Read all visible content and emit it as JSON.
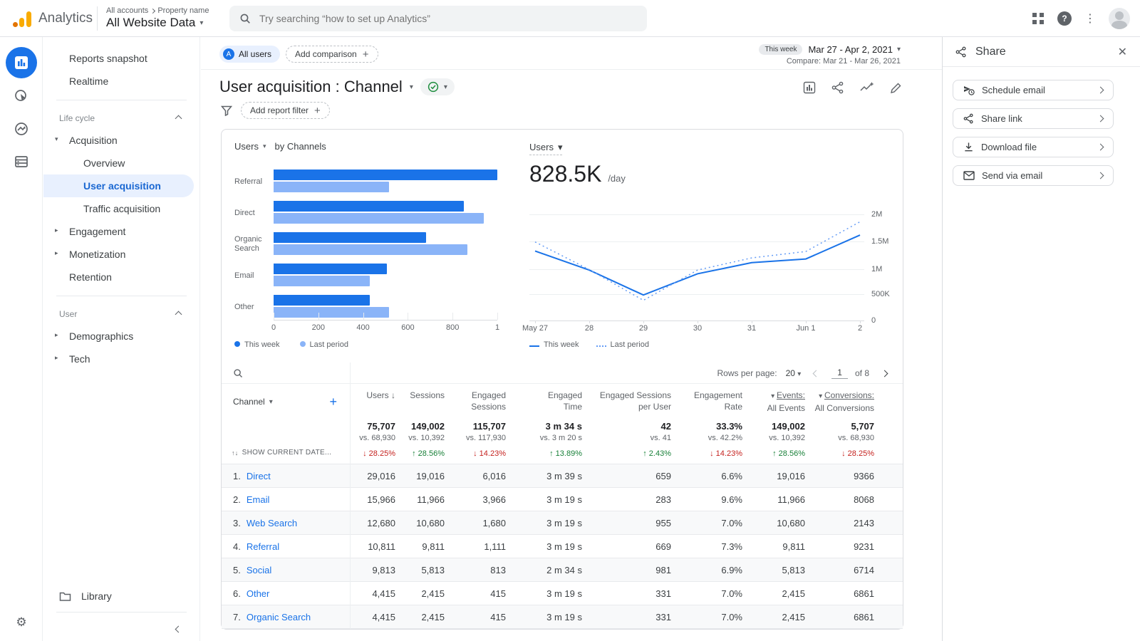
{
  "header": {
    "product": "Analytics",
    "breadcrumb": {
      "level1": "All accounts",
      "level2": "Property name"
    },
    "property_name": "All Website Data",
    "search_placeholder": "Try searching “how to set up Analytics”"
  },
  "sidebar": {
    "top_items": [
      {
        "label": "Reports snapshot"
      },
      {
        "label": "Realtime"
      }
    ],
    "sections": [
      {
        "title": "Life cycle",
        "items": [
          {
            "label": "Acquisition",
            "expand": "down",
            "children": [
              {
                "label": "Overview"
              },
              {
                "label": "User acquisition",
                "selected": true
              },
              {
                "label": "Traffic acquisition"
              }
            ]
          },
          {
            "label": "Engagement",
            "expand": "right"
          },
          {
            "label": "Monetization",
            "expand": "right"
          },
          {
            "label": "Retention"
          }
        ]
      },
      {
        "title": "User",
        "items": [
          {
            "label": "Demographics",
            "expand": "right"
          },
          {
            "label": "Tech",
            "expand": "right"
          }
        ]
      }
    ],
    "library_label": "Library"
  },
  "toolbar": {
    "all_users_icon": "A",
    "all_users_chip": "All users",
    "add_comparison": "Add comparison",
    "this_week_badge": "This week",
    "date_range": "Mar 27 - Apr 2, 2021",
    "compare_label": "Compare: Mar 21 - Mar 26, 2021"
  },
  "report": {
    "title": "User acquisition : Channel",
    "add_filter": "Add report filter"
  },
  "chart_data": [
    {
      "type": "bar",
      "orientation": "horizontal",
      "metric_label": "Users",
      "title_suffix": "by Channels",
      "categories": [
        "Referral",
        "Direct",
        "Organic Search",
        "Email",
        "Other"
      ],
      "series": [
        {
          "name": "This week",
          "color": "#1a73e8",
          "values": [
            1000,
            850,
            680,
            505,
            430
          ]
        },
        {
          "name": "Last period",
          "color": "#8ab4f8",
          "values": [
            515,
            940,
            865,
            430,
            515
          ]
        }
      ],
      "xlim": [
        0,
        1000
      ],
      "xticks": [
        "0",
        "200",
        "400",
        "600",
        "800",
        "1"
      ]
    },
    {
      "type": "line",
      "metric_label": "Users",
      "big_number": "828.5K",
      "big_number_suffix": "/day",
      "x": [
        "May 27",
        "28",
        "29",
        "30",
        "31",
        "Jun 1",
        "2"
      ],
      "series": [
        {
          "name": "This week",
          "style": "solid",
          "color": "#1a73e8",
          "values": [
            1310000,
            950000,
            480000,
            880000,
            1090000,
            1160000,
            1610000
          ]
        },
        {
          "name": "Last period",
          "style": "dotted",
          "color": "#669df6",
          "values": [
            1480000,
            960000,
            380000,
            950000,
            1180000,
            1300000,
            1860000
          ]
        }
      ],
      "ylim": [
        0,
        2000000
      ],
      "yticks": [
        "0",
        "500K",
        "1M",
        "1.5M",
        "2M"
      ],
      "legend_position": "bottom"
    }
  ],
  "table": {
    "channel_header": "Channel",
    "show_current": "SHOW CURRENT DATE...",
    "pagination": {
      "rows_label": "Rows per page:",
      "rows_value": "20",
      "page": "1",
      "of_label": "of 8"
    },
    "columns": [
      {
        "l1": "Users",
        "l2": "",
        "sort": true
      },
      {
        "l1": "Sessions",
        "l2": ""
      },
      {
        "l1": "Engaged",
        "l2": "Sessions"
      },
      {
        "l1": "Engaged",
        "l2": "Time"
      },
      {
        "l1": "Engaged Sessions",
        "l2": "per User"
      },
      {
        "l1": "Engagement",
        "l2": "Rate"
      },
      {
        "l1": "Events:",
        "l2": "All Events",
        "caret": true,
        "underline": true
      },
      {
        "l1": "Conversions:",
        "l2": "All Conversions",
        "caret": true,
        "underline": true
      }
    ],
    "totals": [
      {
        "v": "75,707",
        "vs": "vs. 68,930",
        "chg": "28.25%",
        "dir": "down"
      },
      {
        "v": "149,002",
        "vs": "vs. 10,392",
        "chg": "28.56%",
        "dir": "up"
      },
      {
        "v": "115,707",
        "vs": "vs. 117,930",
        "chg": "14.23%",
        "dir": "down"
      },
      {
        "v": "3 m 34 s",
        "vs": "vs. 3 m 20 s",
        "chg": "13.89%",
        "dir": "up"
      },
      {
        "v": "42",
        "vs": "vs. 41",
        "chg": "2.43%",
        "dir": "up"
      },
      {
        "v": "33.3%",
        "vs": "vs. 42.2%",
        "chg": "14.23%",
        "dir": "down"
      },
      {
        "v": "149,002",
        "vs": "vs. 10,392",
        "chg": "28.56%",
        "dir": "up"
      },
      {
        "v": "5,707",
        "vs": "vs. 68,930",
        "chg": "28.25%",
        "dir": "down"
      }
    ],
    "rows": [
      {
        "n": "1.",
        "channel": "Direct",
        "cells": [
          "29,016",
          "19,016",
          "6,016",
          "3 m 39 s",
          "659",
          "6.6%",
          "19,016",
          "9366"
        ]
      },
      {
        "n": "2.",
        "channel": "Email",
        "cells": [
          "15,966",
          "11,966",
          "3,966",
          "3 m 19 s",
          "283",
          "9.6%",
          "11,966",
          "8068"
        ]
      },
      {
        "n": "3.",
        "channel": "Web Search",
        "cells": [
          "12,680",
          "10,680",
          "1,680",
          "3 m 19 s",
          "955",
          "7.0%",
          "10,680",
          "2143"
        ]
      },
      {
        "n": "4.",
        "channel": "Referral",
        "cells": [
          "10,811",
          "9,811",
          "1,111",
          "3 m 19 s",
          "669",
          "7.3%",
          "9,811",
          "9231"
        ]
      },
      {
        "n": "5.",
        "channel": "Social",
        "cells": [
          "9,813",
          "5,813",
          "813",
          "2 m 34 s",
          "981",
          "6.9%",
          "5,813",
          "6714"
        ]
      },
      {
        "n": "6.",
        "channel": "Other",
        "cells": [
          "4,415",
          "2,415",
          "415",
          "3 m 19 s",
          "331",
          "7.0%",
          "2,415",
          "6861"
        ]
      },
      {
        "n": "7.",
        "channel": "Organic Search",
        "cells": [
          "4,415",
          "2,415",
          "415",
          "3 m 19 s",
          "331",
          "7.0%",
          "2,415",
          "6861"
        ]
      }
    ]
  },
  "share_panel": {
    "title": "Share",
    "items": [
      {
        "icon": "schedule-email-icon",
        "label": "Schedule email"
      },
      {
        "icon": "share-link-icon",
        "label": "Share link"
      },
      {
        "icon": "download-icon",
        "label": "Download file"
      },
      {
        "icon": "send-email-icon",
        "label": "Send via email"
      }
    ]
  },
  "colors": {
    "primary": "#1a73e8",
    "light_series": "#8ab4f8",
    "dotted_series": "#669df6",
    "up": "#188038",
    "down": "#c5221f"
  }
}
